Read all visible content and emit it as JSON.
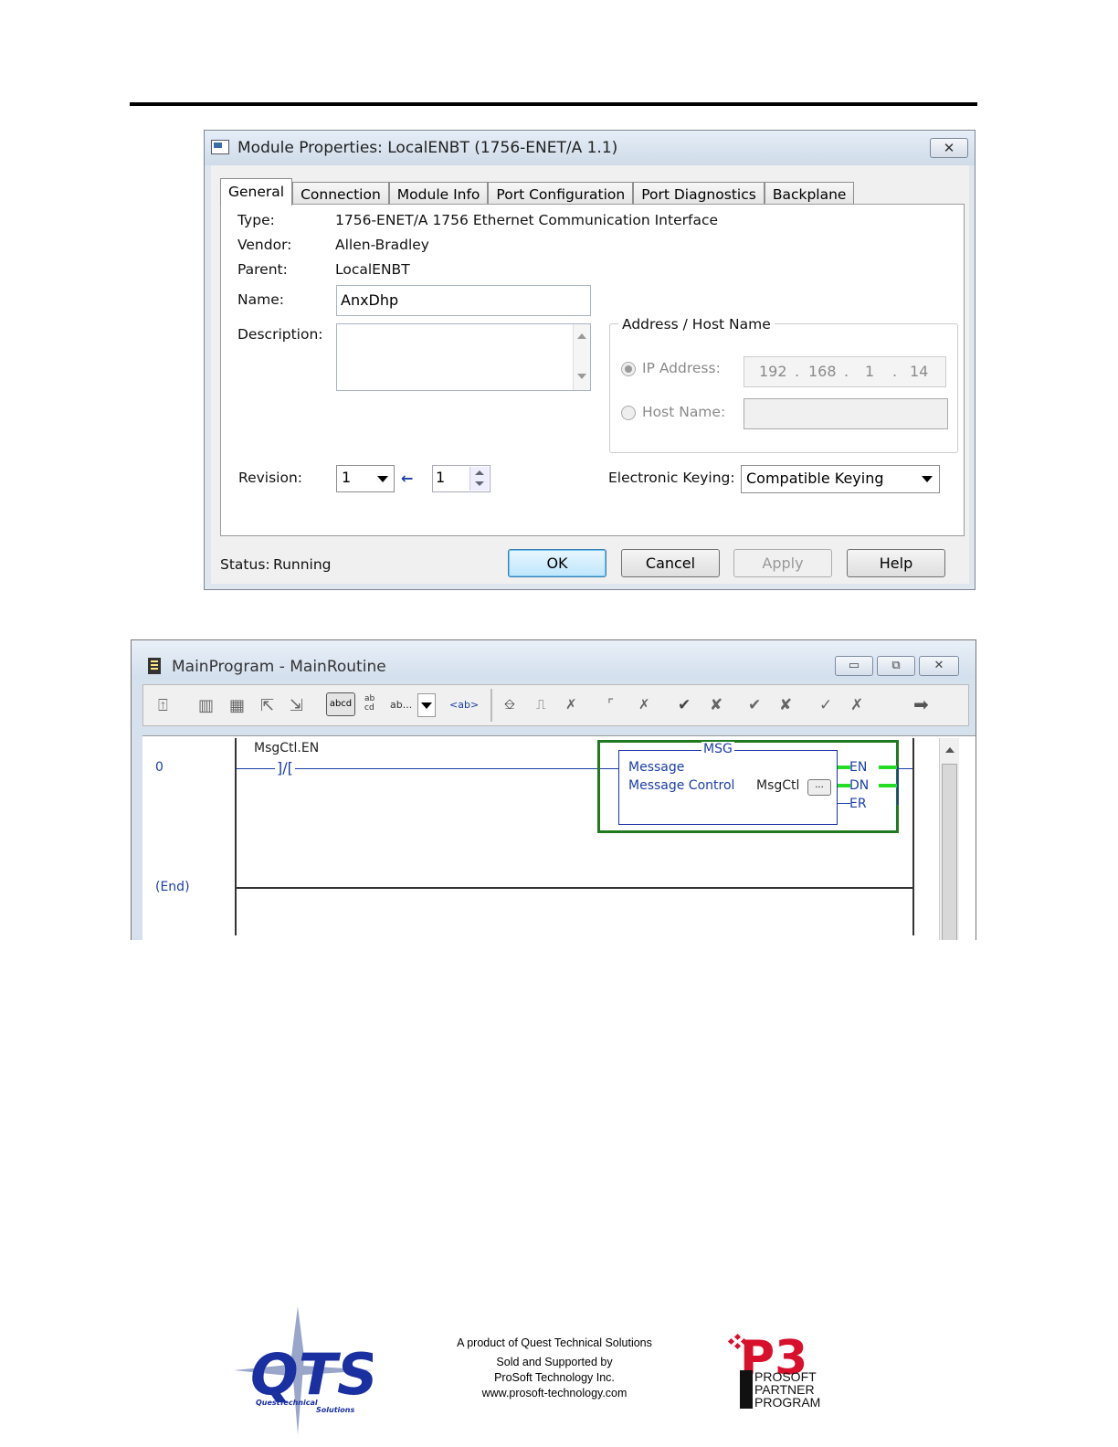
{
  "dialog": {
    "title": "Module Properties: LocalENBT (1756-ENET/A 1.1)",
    "close_glyph": "✕",
    "tabs": [
      "General",
      "Connection",
      "Module Info",
      "Port Configuration",
      "Port Diagnostics",
      "Backplane"
    ],
    "active_tab": "General",
    "type_label": "Type:",
    "type_value": "1756-ENET/A 1756 Ethernet Communication Interface",
    "vendor_label": "Vendor:",
    "vendor_value": "Allen-Bradley",
    "parent_label": "Parent:",
    "parent_value": "LocalENBT",
    "name_label": "Name:",
    "name_value": "AnxDhp",
    "description_label": "Description:",
    "description_value": "",
    "address_group_title": "Address / Host Name",
    "ip_label": "IP Address:",
    "ip_octets": [
      "192",
      "168",
      "1",
      "14"
    ],
    "host_label": "Host Name:",
    "host_value": "",
    "revision_label": "Revision:",
    "revision_major": "1",
    "revision_minor": "1",
    "keying_label": "Electronic Keying:",
    "keying_value": "Compatible Keying",
    "status_label": "Status:",
    "status_value": "Running",
    "buttons": {
      "ok": "OK",
      "cancel": "Cancel",
      "apply": "Apply",
      "help": "Help"
    }
  },
  "ladder": {
    "title": "MainProgram - MainRoutine",
    "window_buttons": [
      "▭",
      "⧉",
      "✕"
    ],
    "toolbar_text": {
      "abcd": "abcd",
      "abcd_stack": "ab cd",
      "ab_more": "ab...",
      "ab_tag": "<ab>"
    },
    "rung_number": "0",
    "end_label": "(End)",
    "contact_tag": "MsgCtl.EN",
    "contact_symbol": "]/[",
    "instruction": "MSG",
    "instruction_line1": "Message",
    "instruction_line2": "Message Control",
    "instruction_operand": "MsgCtl",
    "operand_button": "...",
    "outputs": [
      "EN",
      "DN",
      "ER"
    ]
  },
  "footer": {
    "line1": "A product of Quest Technical Solutions",
    "line2": "Sold and Supported by",
    "line3": "ProSoft Technology Inc.",
    "line4": "www.prosoft-technology.com",
    "qts_letters": "QTS",
    "qts_words": [
      "Quest",
      "Technical",
      "Solutions"
    ],
    "p3_mark": "P3",
    "p3_lines": [
      "PROSOFT",
      "PARTNER",
      "PROGRAM"
    ]
  },
  "colors": {
    "ladder_blue": "#1b3ea8",
    "rung_green": "#1f7a1f",
    "energized_green": "#22dd22",
    "qts_blue": "#1a2fa0",
    "p3_red": "#d8102c"
  }
}
